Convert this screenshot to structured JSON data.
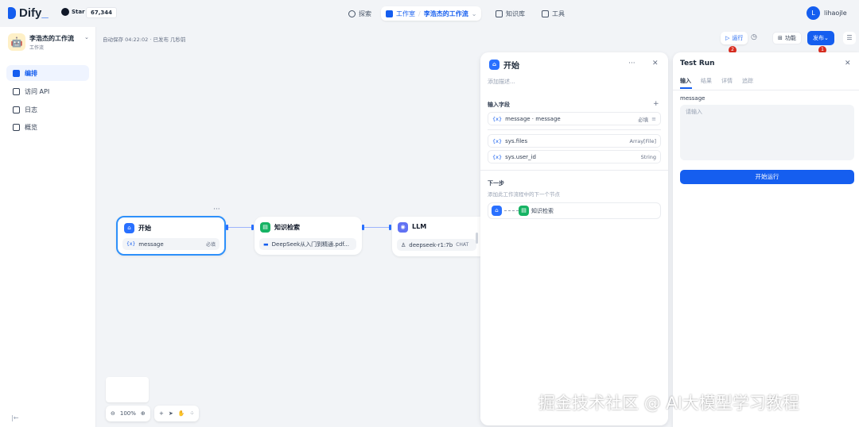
{
  "header": {
    "logo": "Dify",
    "github_label": "Star",
    "github_count": "67,344",
    "nav": [
      {
        "label": "探索"
      },
      {
        "label": "工作室"
      },
      {
        "label": "知识库"
      },
      {
        "label": "工具"
      }
    ],
    "breadcrumb_app": "李浩杰的工作流",
    "user_initial": "L",
    "username": "lihaojle"
  },
  "sidebar": {
    "app_name": "李浩杰的工作流",
    "app_type": "工作流",
    "items": [
      {
        "label": "编排",
        "active": true
      },
      {
        "label": "访问 API"
      },
      {
        "label": "日志"
      },
      {
        "label": "概览"
      }
    ]
  },
  "canvas": {
    "autosave": "自动保存 04:22:02 · 已发布 几秒前",
    "run_label": "运行",
    "features_label": "功能",
    "publish_label": "发布",
    "badges": [
      "2",
      "1"
    ],
    "zoom": "100%",
    "nodes": {
      "start": {
        "title": "开始",
        "var": "{x}",
        "row": "message",
        "tag": "必填"
      },
      "knowledge": {
        "title": "知识检索",
        "row": "DeepSeek从入门到精通.pdf..."
      },
      "llm": {
        "title": "LLM",
        "row": "deepseek-r1:7b",
        "tag": "CHAT"
      }
    }
  },
  "start_panel": {
    "title": "开始",
    "description_placeholder": "添加描述...",
    "input_fields_label": "输入字段",
    "fields": [
      {
        "var": "{x}",
        "name": "message · message",
        "right": "必填"
      },
      {
        "var": "{x}",
        "name": "sys.files",
        "right": "Array[File]"
      },
      {
        "var": "{x}",
        "name": "sys.user_id",
        "right": "String"
      }
    ],
    "next_label": "下一步",
    "next_desc": "添加此工作流程中的下一个节点",
    "next_node": "知识检索"
  },
  "test_run": {
    "title": "Test Run",
    "tabs": [
      "输入",
      "结果",
      "详情",
      "追踪"
    ],
    "field_label": "message",
    "placeholder": "请输入",
    "start_button": "开始运行"
  },
  "watermark": "掘金技术社区 @ AI大模型学习教程",
  "colors": {
    "accent": "#155eef",
    "badge": "#d92d20",
    "start_icon": "#2970ff",
    "knowledge_icon": "#16b364",
    "llm_icon": "#6172f3"
  }
}
